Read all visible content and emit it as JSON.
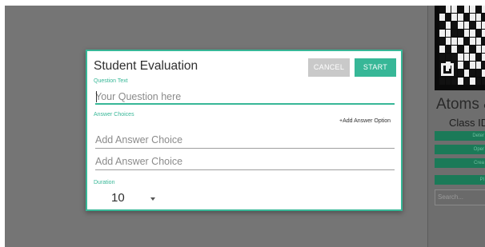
{
  "sidebar": {
    "title": "Atoms &",
    "class_id_label": "Class ID:",
    "buttons": [
      "Deter",
      "Oper",
      "Crea",
      "Pl"
    ],
    "search_placeholder": "Search..."
  },
  "modal": {
    "title": "Student Evaluation",
    "cancel_label": "CANCEL",
    "start_label": "START",
    "question_label": "Question Text",
    "question_placeholder": "Your Question here",
    "answers_label": "Answer Choices",
    "add_option_label": "+Add Answer Option",
    "answer_placeholders": [
      "Add Answer Choice",
      "Add Answer Choice"
    ],
    "duration_label": "Duration",
    "duration_value": "10"
  },
  "colors": {
    "accent": "#37b797",
    "overlay": "#757575"
  }
}
